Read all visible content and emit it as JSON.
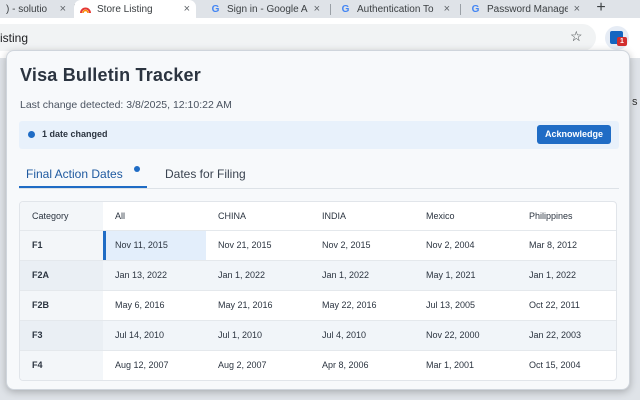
{
  "browser": {
    "tabs": [
      {
        "title": ") - solutio",
        "icon": "partial-tab-icon",
        "active": false
      },
      {
        "title": "Store Listing",
        "icon": "rainbow-icon",
        "active": true
      },
      {
        "title": "Sign in - Google A",
        "icon": "google-icon",
        "active": false
      },
      {
        "title": "Authentication To",
        "icon": "google-icon",
        "active": false
      },
      {
        "title": "Password Manage",
        "icon": "google-icon",
        "active": false
      }
    ],
    "tab_close_glyph": "×",
    "new_tab_glyph": "+",
    "omnibox_text": "isting",
    "bookmark_glyph": "☆",
    "extension_badge": "1",
    "page_peek_text": "s"
  },
  "popup": {
    "title": "Visa Bulletin Tracker",
    "last_change": "Last change detected: 3/8/2025, 12:10:22 AM",
    "alert_text": "1 date changed",
    "acknowledge_label": "Acknowledge",
    "tabs": [
      {
        "label": "Final Action Dates",
        "active": true,
        "has_indicator": true
      },
      {
        "label": "Dates for Filing",
        "active": false,
        "has_indicator": false
      }
    ],
    "accent_color": "#1f6cc5",
    "table": {
      "headers": [
        "Category",
        "All",
        "CHINA",
        "INDIA",
        "Mexico",
        "Philippines"
      ],
      "rows": [
        {
          "category": "F1",
          "cells": [
            "Nov 11, 2015",
            "Nov 21, 2015",
            "Nov 2, 2015",
            "Nov 2, 2004",
            "Mar 8, 2012"
          ],
          "highlight_col": 0
        },
        {
          "category": "F2A",
          "cells": [
            "Jan 13, 2022",
            "Jan 1, 2022",
            "Jan 1, 2022",
            "May 1, 2021",
            "Jan 1, 2022"
          ]
        },
        {
          "category": "F2B",
          "cells": [
            "May 6, 2016",
            "May 21, 2016",
            "May 22, 2016",
            "Jul 13, 2005",
            "Oct 22, 2011"
          ]
        },
        {
          "category": "F3",
          "cells": [
            "Jul 14, 2010",
            "Jul 1, 2010",
            "Jul 4, 2010",
            "Nov 22, 2000",
            "Jan 22, 2003"
          ]
        },
        {
          "category": "F4",
          "cells": [
            "Aug 12, 2007",
            "Aug 2, 2007",
            "Apr 8, 2006",
            "Mar 1, 2001",
            "Oct 15, 2004"
          ]
        }
      ]
    }
  }
}
